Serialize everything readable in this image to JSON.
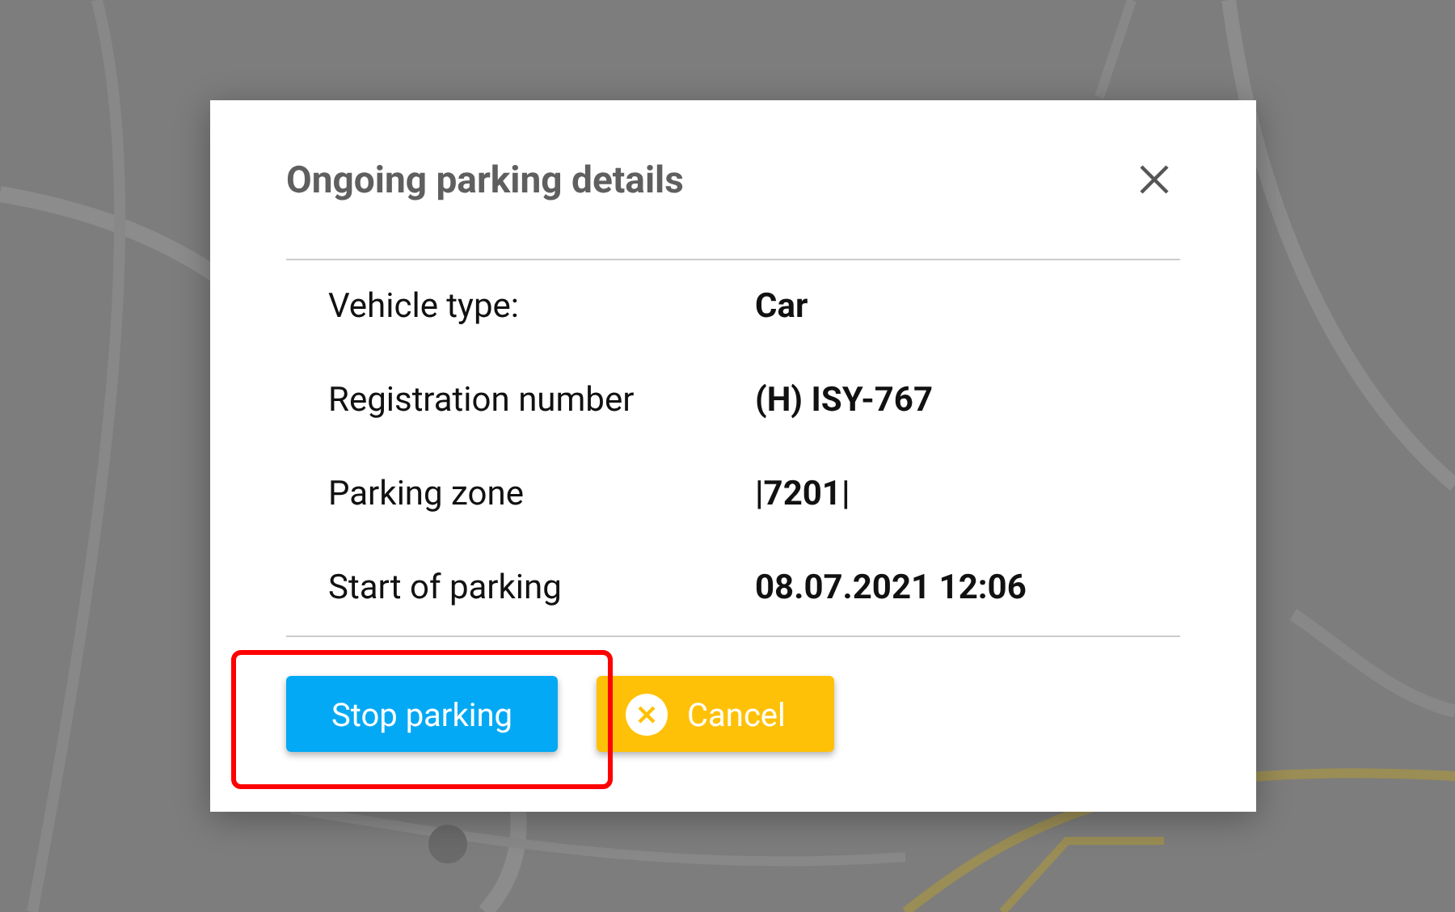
{
  "dialog": {
    "title": "Ongoing parking details",
    "details": [
      {
        "label": "Vehicle type:",
        "value": "Car"
      },
      {
        "label": "Registration number",
        "value": "(H) ISY-767"
      },
      {
        "label": "Parking zone",
        "value": "|7201|"
      },
      {
        "label": "Start of parking",
        "value": "08.07.2021 12:06"
      }
    ],
    "buttons": [
      {
        "kind": "primary",
        "label": "Stop parking",
        "highlighted": true
      },
      {
        "kind": "cancel",
        "label": "Cancel",
        "highlighted": false
      }
    ]
  }
}
